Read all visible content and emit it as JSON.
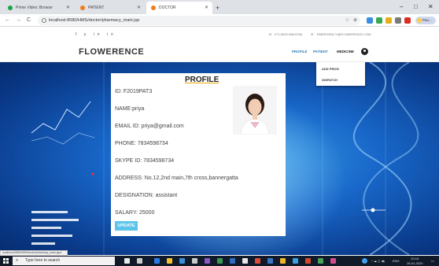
{
  "browser": {
    "tabs": [
      {
        "label": "Prime Video: Browse",
        "icon_color": "#1aa34a"
      },
      {
        "label": "PATIENT",
        "icon_color": "#f07d1a"
      },
      {
        "label": "DOCTOR",
        "icon_color": "#f07d1a",
        "active": true
      }
    ],
    "new_tab_glyph": "+",
    "window_controls": [
      "–",
      "□",
      "✕"
    ],
    "nav": {
      "back": "←",
      "forward": "→",
      "reload": "C",
      "home": "⌂"
    },
    "url": "localhost:8080/HMS/doctor/pharmacy_main.jsp",
    "profile_label": "Pau..."
  },
  "site": {
    "social_icons": [
      "f",
      "y",
      "in",
      "in"
    ],
    "phone": "071-6522-568 6766",
    "email": "EMERGENCY@FLOWERENCE.COM",
    "brand": "FLOWERENCE",
    "menu": {
      "home": "PROFILE",
      "patient": "PATIENT",
      "medicine": "MEDICINE"
    },
    "dropdown": {
      "add_price": "ADD PRICE",
      "dispatch": "DISPATCH"
    }
  },
  "profile": {
    "title": "PROFILE",
    "fields": [
      "ID: F2019PAT3",
      "NAME:priya",
      "EMAIL ID: priya@gmail.com",
      "PHONE: 7834598734",
      "SKYPE ID: 7834598734",
      "ADDRESS: No.12,2nd main,7th cross,bannergatta",
      "DESIGNATION: assistant",
      "SALARY: 25000"
    ],
    "update_label": "UPDATE"
  },
  "status_bar": "localhost:8080/HMS/doctor/pharmacy_main.jsp#",
  "taskbar": {
    "search_placeholder": "Type here to search",
    "search_icon": "magnifier-icon",
    "language": "ENG",
    "time": "20:16",
    "date": "28-01-2020"
  }
}
